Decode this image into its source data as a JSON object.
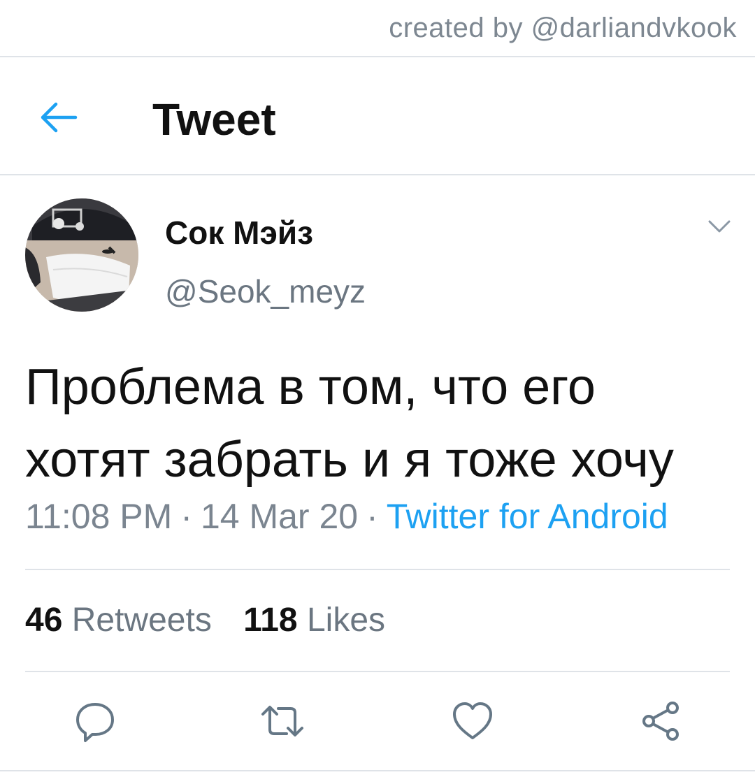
{
  "watermark": "created by @darliandvkook",
  "header": {
    "title": "Tweet",
    "back_icon": "arrow-left-icon",
    "accent": "#1da1f2"
  },
  "tweet": {
    "author_name": "Сок Мэйз",
    "handle": "@Seok_meyz",
    "text": "Проблема в том, что его\nхотят забрать и я тоже хочу",
    "time": "11:08 PM",
    "date": "14 Mar 20",
    "separator": "·",
    "source": "Twitter for Android",
    "retweets_count": "46",
    "retweets_label": "Retweets",
    "likes_count": "118",
    "likes_label": "Likes"
  },
  "actions": [
    {
      "icon": "reply-icon"
    },
    {
      "icon": "retweet-icon"
    },
    {
      "icon": "like-icon"
    },
    {
      "icon": "share-icon"
    }
  ]
}
